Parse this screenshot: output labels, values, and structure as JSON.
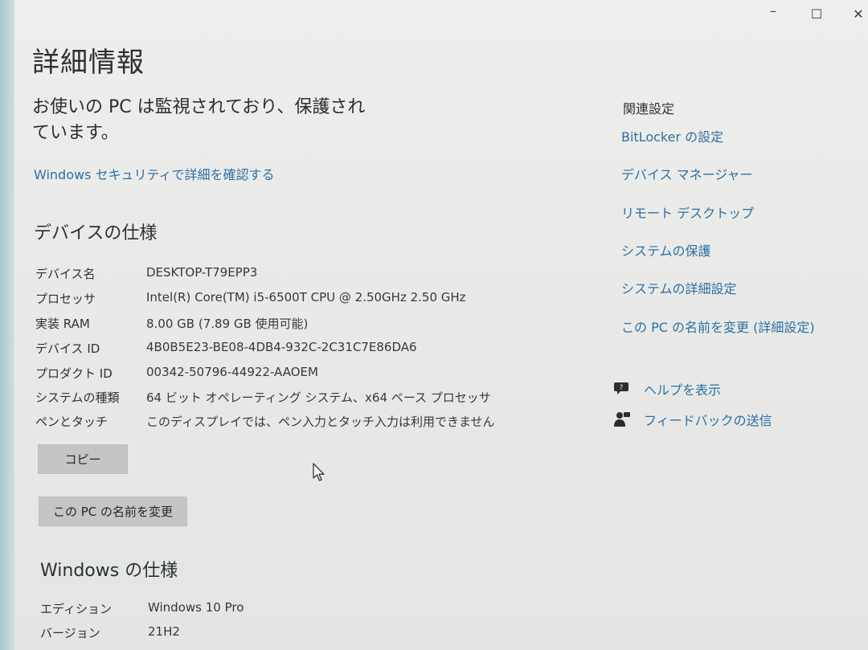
{
  "window": {
    "minimize_glyph": "–",
    "maximize_glyph": "☐",
    "close_glyph": "✕"
  },
  "page": {
    "title": "詳細情報",
    "status": "お使いの PC は監視されており、保護されています。",
    "security_link": "Windows セキュリティで詳細を確認する"
  },
  "device": {
    "heading": "デバイスの仕様",
    "rows": [
      {
        "label": "デバイス名",
        "value": "DESKTOP-T79EPP3"
      },
      {
        "label": "プロセッサ",
        "value": "Intel(R) Core(TM) i5-6500T CPU @ 2.50GHz   2.50 GHz"
      },
      {
        "label": "実装 RAM",
        "value": "8.00 GB (7.89 GB 使用可能)"
      },
      {
        "label": "デバイス ID",
        "value": "4B0B5E23-BE08-4DB4-932C-2C31C7E86DA6"
      },
      {
        "label": "プロダクト ID",
        "value": "00342-50796-44922-AAOEM"
      },
      {
        "label": "システムの種類",
        "value": "64 ビット オペレーティング システム、x64 ベース プロセッサ"
      },
      {
        "label": "ペンとタッチ",
        "value": "このディスプレイでは、ペン入力とタッチ入力は利用できません"
      }
    ],
    "copy_button": "コピー",
    "rename_button": "この PC の名前を変更"
  },
  "windows_spec": {
    "heading": "Windows の仕様",
    "rows": [
      {
        "label": "エディション",
        "value": "Windows 10 Pro"
      },
      {
        "label": "バージョン",
        "value": "21H2"
      }
    ]
  },
  "related": {
    "title": "関連設定",
    "links": [
      "BitLocker の設定",
      "デバイス マネージャー",
      "リモート デスクトップ",
      "システムの保護",
      "システムの詳細設定",
      "この PC の名前を変更 (詳細設定)"
    ],
    "help": "ヘルプを表示",
    "feedback": "フィードバックの送信"
  },
  "colors": {
    "link": "#2d6fa3",
    "button": "#c4c5c4",
    "window_bg": "#eeeeec"
  },
  "icons": {
    "help": "help-chat-icon",
    "feedback": "feedback-person-icon",
    "cursor": "mouse-pointer-icon"
  }
}
